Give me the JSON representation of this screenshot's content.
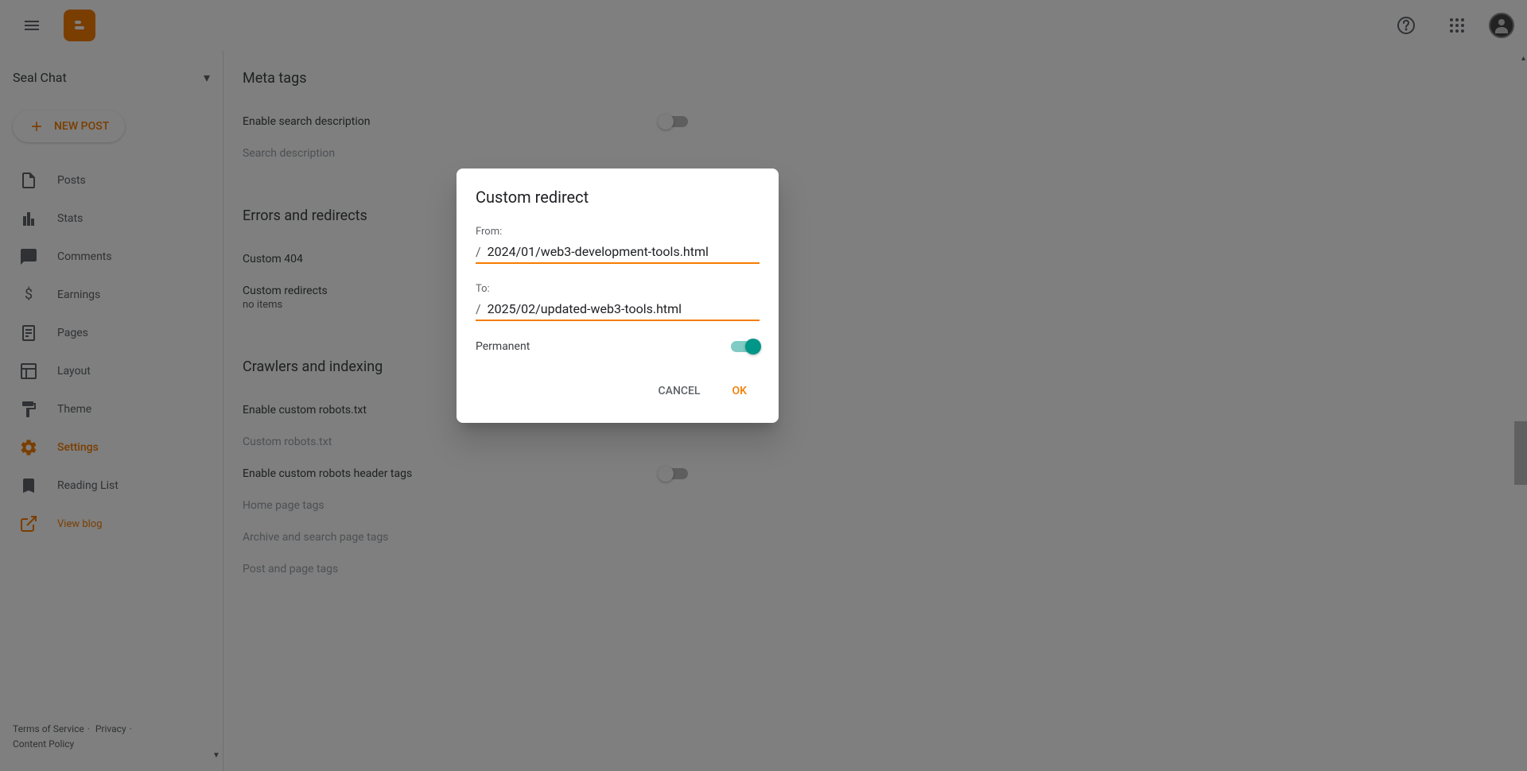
{
  "header": {
    "blog_name": "Seal Chat"
  },
  "sidebar": {
    "new_post": "NEW POST",
    "items": [
      {
        "label": "Posts",
        "icon": "posts"
      },
      {
        "label": "Stats",
        "icon": "stats"
      },
      {
        "label": "Comments",
        "icon": "comments"
      },
      {
        "label": "Earnings",
        "icon": "earnings"
      },
      {
        "label": "Pages",
        "icon": "pages"
      },
      {
        "label": "Layout",
        "icon": "layout"
      },
      {
        "label": "Theme",
        "icon": "theme"
      },
      {
        "label": "Settings",
        "icon": "settings",
        "active": true
      },
      {
        "label": "Reading List",
        "icon": "reading"
      }
    ],
    "view_blog": "View blog",
    "footer": {
      "terms": "Terms of Service",
      "privacy": "Privacy",
      "content_policy": "Content Policy"
    }
  },
  "settings": {
    "sections": {
      "meta": {
        "title": "Meta tags",
        "enable_search": "Enable search description",
        "search_desc": "Search description"
      },
      "errors": {
        "title": "Errors and redirects",
        "custom_404": "Custom 404",
        "custom_redirects": "Custom redirects",
        "no_items": "no items"
      },
      "crawlers": {
        "title": "Crawlers and indexing",
        "enable_robots": "Enable custom robots.txt",
        "custom_robots": "Custom robots.txt",
        "enable_header": "Enable custom robots header tags",
        "home_tags": "Home page tags",
        "archive_tags": "Archive and search page tags",
        "post_tags": "Post and page tags"
      }
    }
  },
  "dialog": {
    "title": "Custom redirect",
    "from_label": "From:",
    "from_prefix": "/",
    "from_value": "2024/01/web3-development-tools.html",
    "to_label": "To:",
    "to_prefix": "/",
    "to_value": "2025/02/updated-web3-tools.html",
    "permanent": "Permanent",
    "cancel": "CANCEL",
    "ok": "OK"
  }
}
